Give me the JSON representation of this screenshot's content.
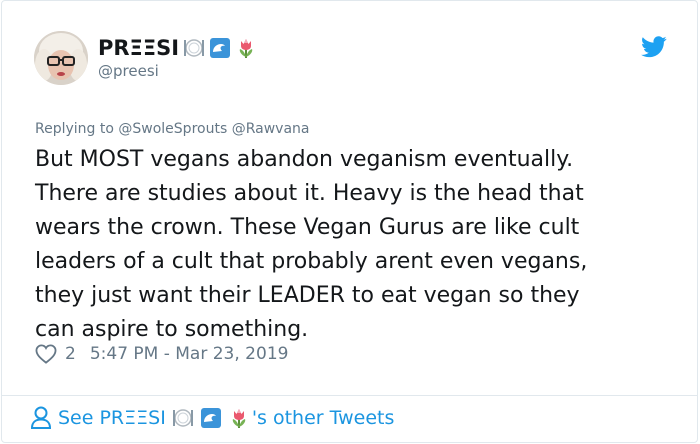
{
  "tweet": {
    "display_name": "PRΞΞSI",
    "handle": "@preesi",
    "name_emojis": [
      "fork-and-knife-with-plate-emoji",
      "water-wave-emoji",
      "tulip-emoji"
    ],
    "replying_prefix": "Replying to",
    "replying_to": [
      "@SwoleSprouts",
      "@Rawvana"
    ],
    "text": "But MOST vegans abandon veganism eventually.\nThere are studies about it. Heavy is the head that\nwears the crown. These Vegan Gurus are like cult\nleaders of a cult that probably arent even vegans,\nthey just want their LEADER to eat vegan so they\ncan aspire to something.",
    "likes": "2",
    "timestamp": "5:47 PM - Mar 23, 2019"
  },
  "footer": {
    "see_prefix": "See PRΞΞSI",
    "see_suffix": "'s other Tweets"
  },
  "colors": {
    "link_blue": "#1b95e0",
    "twitter_blue": "#1da1f2",
    "gray_text": "#657786",
    "border": "#e1e8ed"
  }
}
